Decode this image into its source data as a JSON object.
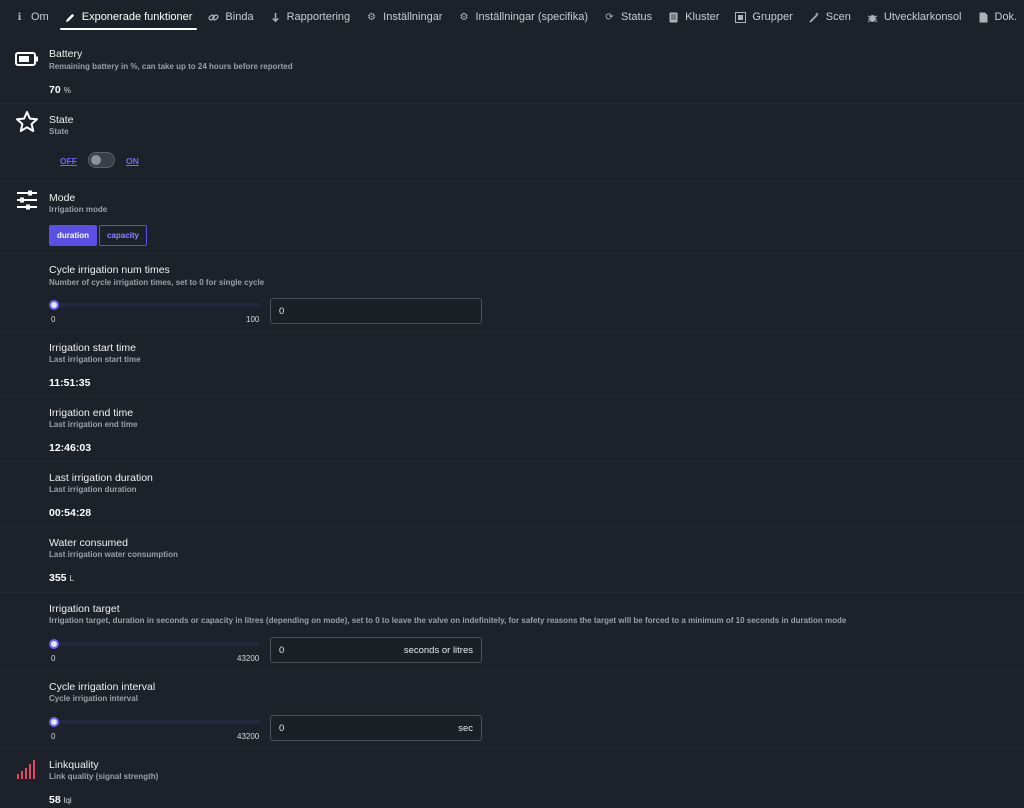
{
  "tabs": [
    {
      "label": "Om",
      "icon": "info-icon"
    },
    {
      "label": "Exponerade funktioner",
      "icon": "pencil-icon",
      "active": true
    },
    {
      "label": "Binda",
      "icon": "link-icon"
    },
    {
      "label": "Rapportering",
      "icon": "download-arrow-icon"
    },
    {
      "label": "Inställningar",
      "icon": "gear-icon"
    },
    {
      "label": "Inställningar (specifika)",
      "icon": "gear-icon"
    },
    {
      "label": "Status",
      "icon": "refresh-icon"
    },
    {
      "label": "Kluster",
      "icon": "document-icon"
    },
    {
      "label": "Grupper",
      "icon": "grid-icon"
    },
    {
      "label": "Scen",
      "icon": "wand-icon"
    },
    {
      "label": "Utvecklarkonsol",
      "icon": "bug-icon"
    },
    {
      "label": "Dok.",
      "icon": "file-icon"
    }
  ],
  "battery": {
    "title": "Battery",
    "desc": "Remaining battery in %, can take up to 24 hours before reported",
    "value": "70",
    "unit": "%"
  },
  "state": {
    "title": "State",
    "desc": "State",
    "off_label": "OFF",
    "on_label": "ON"
  },
  "mode": {
    "title": "Mode",
    "desc": "Irrigation mode",
    "options": [
      "duration",
      "capacity"
    ],
    "selected": "duration"
  },
  "cycle_times": {
    "title": "Cycle irrigation num times",
    "desc": "Number of cycle irrigation times, set to 0 for single cycle",
    "min": "0",
    "max": "100",
    "value": "0"
  },
  "start_time": {
    "title": "Irrigation start time",
    "desc": "Last irrigation start time",
    "value": "11:51:35"
  },
  "end_time": {
    "title": "Irrigation end time",
    "desc": "Last irrigation end time",
    "value": "12:46:03"
  },
  "last_duration": {
    "title": "Last irrigation duration",
    "desc": "Last irrigation duration",
    "value": "00:54:28"
  },
  "water": {
    "title": "Water consumed",
    "desc": "Last irrigation water consumption",
    "value": "355",
    "unit": "L"
  },
  "target": {
    "title": "Irrigation target",
    "desc": "Irrigation target, duration in seconds or capacity in litres (depending on mode), set to 0 to leave the valve on indefinitely, for safety reasons the target will be forced to a minimum of 10 seconds in duration mode",
    "min": "0",
    "max": "43200",
    "value": "0",
    "unit": "seconds or litres"
  },
  "interval": {
    "title": "Cycle irrigation interval",
    "desc": "Cycle irrigation interval",
    "min": "0",
    "max": "43200",
    "value": "0",
    "unit": "sec"
  },
  "linkquality": {
    "title": "Linkquality",
    "desc": "Link quality (signal strength)",
    "value": "58",
    "unit": "lqi"
  },
  "colors": {
    "accent": "#5b4fe6",
    "signal": "#e04a5f"
  }
}
